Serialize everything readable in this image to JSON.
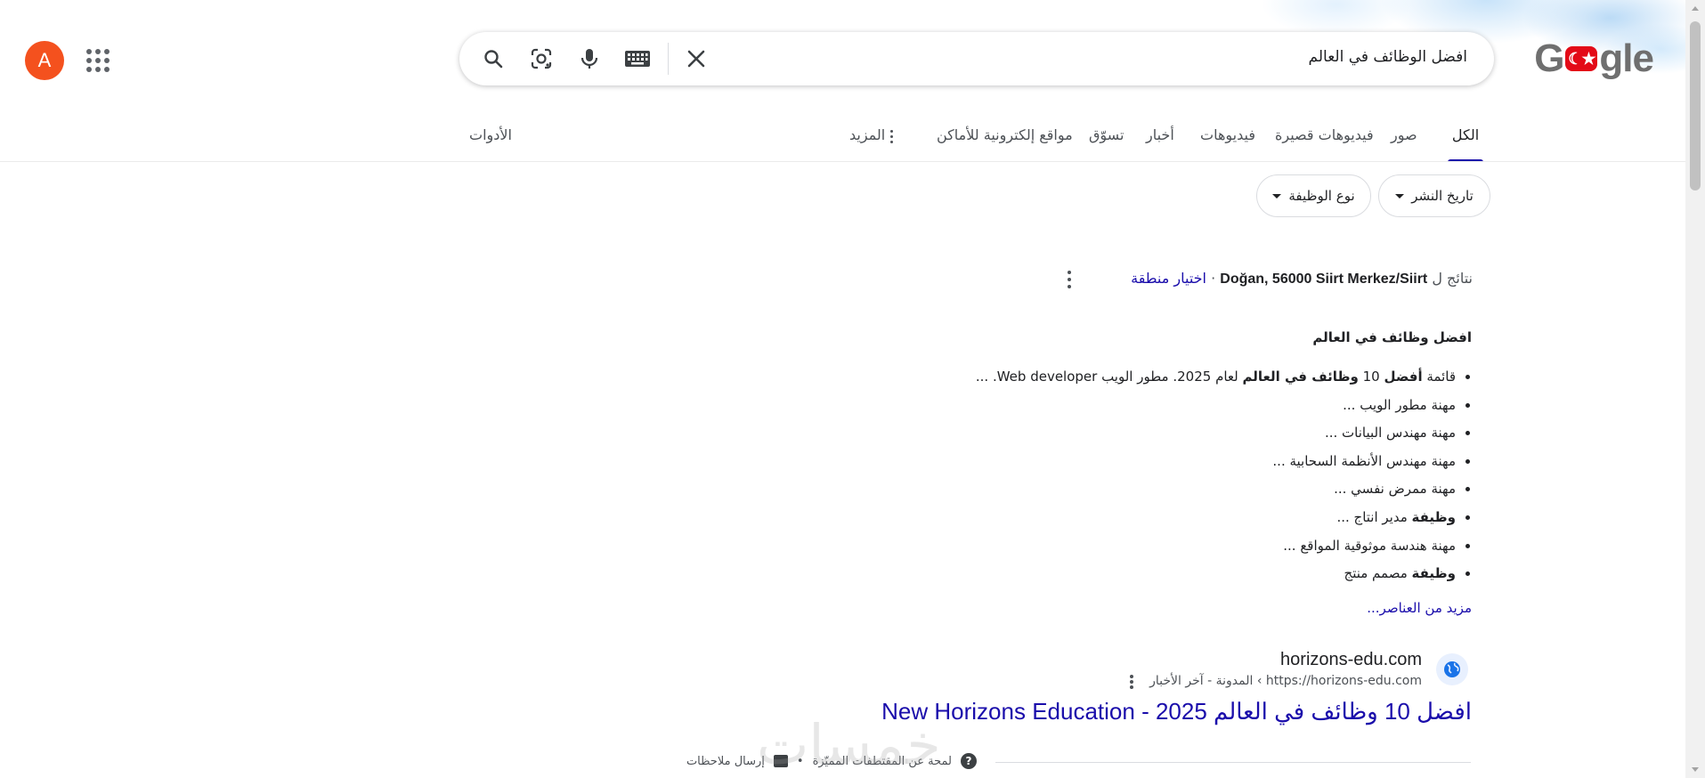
{
  "header": {
    "logo_text_left": "G",
    "logo_text_right": "gle",
    "logo_emblem": "☾★",
    "search_query": "افضل الوظائف في العالم",
    "avatar_letter": "A",
    "icons": [
      "search-icon",
      "google-lens-icon",
      "microphone-icon",
      "keyboard-icon",
      "clear-icon",
      "apps-grid-icon"
    ]
  },
  "tabs": [
    {
      "label": "الكل",
      "active": true
    },
    {
      "label": "صور"
    },
    {
      "label": "فيديوهات قصيرة"
    },
    {
      "label": "فيديوهات"
    },
    {
      "label": "أخبار"
    },
    {
      "label": "تسوّق"
    },
    {
      "label": "مواقع إلكترونية للأماكن"
    },
    {
      "label": "المزيد"
    }
  ],
  "tools_label": "الأدوات",
  "filters": [
    {
      "label": "تاريخ النشر"
    },
    {
      "label": "نوع الوظيفة"
    }
  ],
  "location": {
    "prefix": "نتائج ل",
    "place": "Doğan, 56000 Siirt Merkez/Siirt",
    "separator": "·",
    "choose_area": "اختيار منطقة"
  },
  "featured_snippet": {
    "title": "افضل وظائف في العالم",
    "items": [
      {
        "parts": [
          [
            "قائمة ",
            false
          ],
          [
            "أفضل",
            true
          ],
          [
            " 10 ",
            false
          ],
          [
            "وظائف في العالم",
            true
          ],
          [
            " لعام 2025. مطور الويب Web developer. ...",
            false
          ]
        ]
      },
      {
        "parts": [
          [
            "مهنة مطور الويب ...",
            false
          ]
        ]
      },
      {
        "parts": [
          [
            "مهنة مهندس البيانات ...",
            false
          ]
        ]
      },
      {
        "parts": [
          [
            "مهنة مهندس الأنظمة السحابية ...",
            false
          ]
        ]
      },
      {
        "parts": [
          [
            "مهنة ممرض نفسي ...",
            false
          ]
        ]
      },
      {
        "parts": [
          [
            "وظيفة",
            true
          ],
          [
            " مدير انتاج ...",
            false
          ]
        ]
      },
      {
        "parts": [
          [
            "مهنة هندسة موثوقية المواقع ...",
            false
          ]
        ]
      },
      {
        "parts": [
          [
            "وظيفة",
            true
          ],
          [
            " مصمم منتج",
            false
          ]
        ]
      }
    ],
    "more_items": "مزيد من العناصر..."
  },
  "result": {
    "site_name": "horizons-edu.com",
    "url": "https://horizons-edu.com › المدونة - آخر الأخبار",
    "title": "افضل 10 وظائف في العالم 2025 - New Horizons Education"
  },
  "footer": {
    "about_snippets": "لمحة عن المقتطفات المميّزة",
    "dot": "•",
    "feedback": "إرسال ملاحظات"
  },
  "watermark": "خمسات",
  "colors": {
    "link": "#1a0dab",
    "avatar_bg": "#f4511e",
    "flag_red": "#e30a17"
  }
}
